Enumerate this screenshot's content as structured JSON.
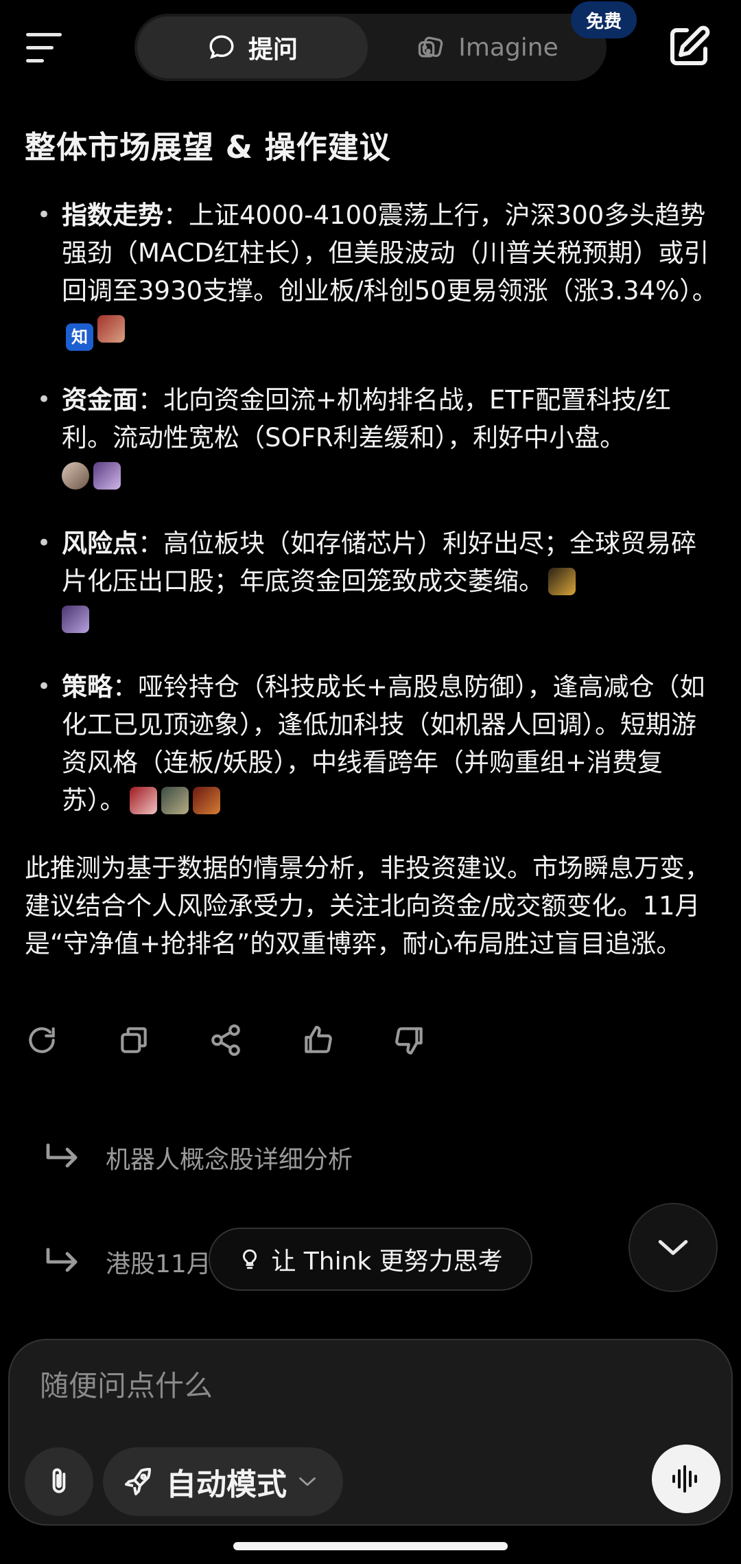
{
  "header": {
    "tabs": [
      {
        "label": "提问",
        "icon": "chat-bubble-icon",
        "active": true
      },
      {
        "label": "Imagine",
        "icon": "dice-icon",
        "active": false
      }
    ],
    "free_badge": "免费"
  },
  "message": {
    "title": "整体市场展望 & 操作建议",
    "bullets": [
      {
        "label": "指数走势",
        "text": "：上证4000-4100震荡上行，沪深300多头趋势强劲（MACD红柱长），但美股波动（川普关税预期）或引回调至3930支撑。创业板/科创50更易领涨（涨3.34%）。",
        "sources": [
          "知"
        ]
      },
      {
        "label": "资金面",
        "text": "：北向资金回流+机构排名战，ETF配置科技/红利。流动性宽松（SOFR利差缓和），利好中小盘。"
      },
      {
        "label": "风险点",
        "text": "：高位板块（如存储芯片）利好出尽；全球贸易碎片化压出口股；年底资金回笼致成交萎缩。"
      },
      {
        "label": "策略",
        "text": "：哑铃持仓（科技成长+高股息防御），逢高减仓（如化工已见顶迹象），逢低加科技（如机器人回调）。短期游资风格（连板/妖股），中线看跨年（并购重组+消费复苏）。"
      }
    ],
    "disclaimer": "此推测为基于数据的情景分析，非投资建议。市场瞬息万变，建议结合个人风险承受力，关注北向资金/成交额变化。11月是“守净值+抢排名”的双重博弈，耐心布局胜过盲目追涨。"
  },
  "actions": [
    "refresh-icon",
    "copy-icon",
    "share-icon",
    "thumbs-up-icon",
    "thumbs-down-icon"
  ],
  "suggestions": [
    {
      "text": "机器人概念股详细分析"
    },
    {
      "text": "港股11月"
    }
  ],
  "think_pill": {
    "label": "让 Think 更努力思考"
  },
  "composer": {
    "placeholder": "随便问点什么",
    "mode_label": "自动模式"
  }
}
